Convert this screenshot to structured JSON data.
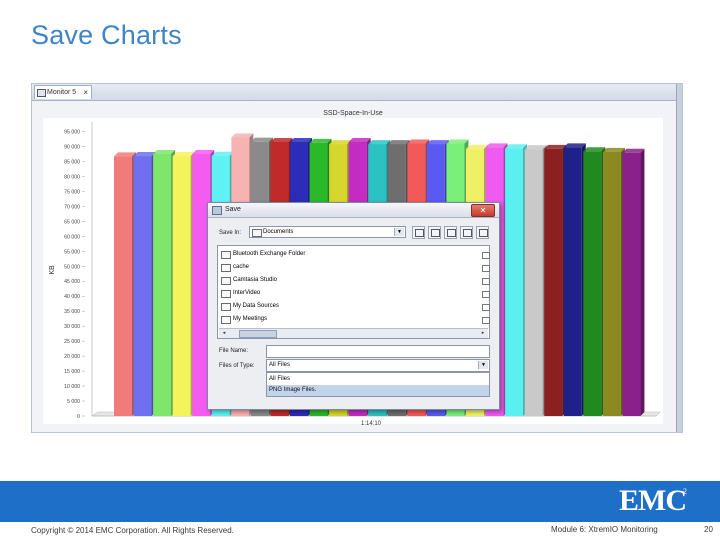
{
  "slide": {
    "title": "Save Charts",
    "footer_copyright": "Copyright © 2014 EMC Corporation. All Rights Reserved.",
    "footer_module": "Module 6: XtremIO Monitoring",
    "page_number": "20",
    "logo_text": "EMC",
    "logo_sup": "2",
    "colors": {
      "title": "#3f84c8",
      "band": "#1e6fc8"
    }
  },
  "app": {
    "tab_label": "Monitor 5",
    "tab_close": "×"
  },
  "chart_data": {
    "type": "bar",
    "title": "SSD-Space-In-Use",
    "ylabel": "KB",
    "xlabel": "1:14:10",
    "yticks": [
      "0",
      "5 000",
      "10 000",
      "15 000",
      "20 000",
      "25 000",
      "30 000",
      "35 000",
      "40 000",
      "45 000",
      "50 000",
      "55 000",
      "60 000",
      "65 000",
      "70 000",
      "75 000",
      "80 000",
      "85 000",
      "90 000",
      "95 000"
    ],
    "ylim": [
      0,
      97500
    ],
    "grid": false,
    "values": [
      86700,
      86800,
      87500,
      86800,
      87500,
      86900,
      93000,
      91600,
      91500,
      91500,
      91200,
      90800,
      91500,
      90800,
      90800,
      91000,
      90800,
      91000,
      89200,
      89700,
      89400,
      89100,
      89200,
      89700,
      88400,
      88200,
      87900
    ],
    "colors": [
      "#f17b7b",
      "#6f6ff0",
      "#7ee66a",
      "#f4f35c",
      "#f45bf1",
      "#5ef2f2",
      "#f7b2b2",
      "#8a8a8a",
      "#c02a2a",
      "#2c2cb8",
      "#2bb82b",
      "#d6d62c",
      "#c22cc2",
      "#2cc2c2",
      "#6e6e6e",
      "#f25a5a",
      "#5a5af2",
      "#7af07a",
      "#f0f066",
      "#f05af0",
      "#5af0f0",
      "#c9c9c9",
      "#8a2020",
      "#20208a",
      "#208a20",
      "#8a8a20",
      "#8a208a"
    ]
  },
  "dialog": {
    "title": "Save",
    "close": "✕",
    "save_in_label": "Save In:",
    "save_in_value": "Documents",
    "files": [
      "Bluetooth Exchange Folder",
      "cache",
      "Camtasia Studio",
      "InterVideo",
      "My Data Sources",
      "My Meetings"
    ],
    "file_name_label": "File Name:",
    "file_name_value": "",
    "files_of_type_label": "Files of Type:",
    "files_of_type_value": "All Files",
    "type_options": [
      "All Files",
      "PNG Image Files."
    ],
    "scroll_left": "◂",
    "scroll_right": "▸",
    "arrow": "▼"
  }
}
